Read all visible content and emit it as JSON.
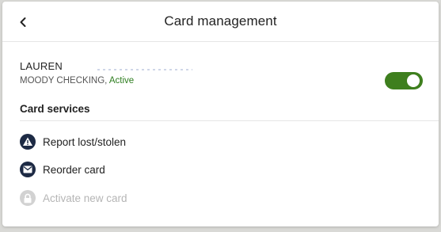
{
  "header": {
    "title": "Card management",
    "back_icon": "chevron-left-icon"
  },
  "account": {
    "owner": "LAUREN",
    "account_name": "MOODY CHECKING, ",
    "status": "Active",
    "toggle_on": true
  },
  "services": {
    "title": "Card services",
    "items": [
      {
        "label": "Report lost/stolen",
        "icon": "warning-icon",
        "enabled": true
      },
      {
        "label": "Reorder card",
        "icon": "envelope-icon",
        "enabled": true
      },
      {
        "label": "Activate new card",
        "icon": "lock-icon",
        "enabled": false
      }
    ]
  },
  "colors": {
    "accent_green": "#3e7f1e",
    "status_green": "#2e7d1f",
    "icon_navy": "#1d2a44",
    "disabled_gray": "#b5b5b5"
  }
}
